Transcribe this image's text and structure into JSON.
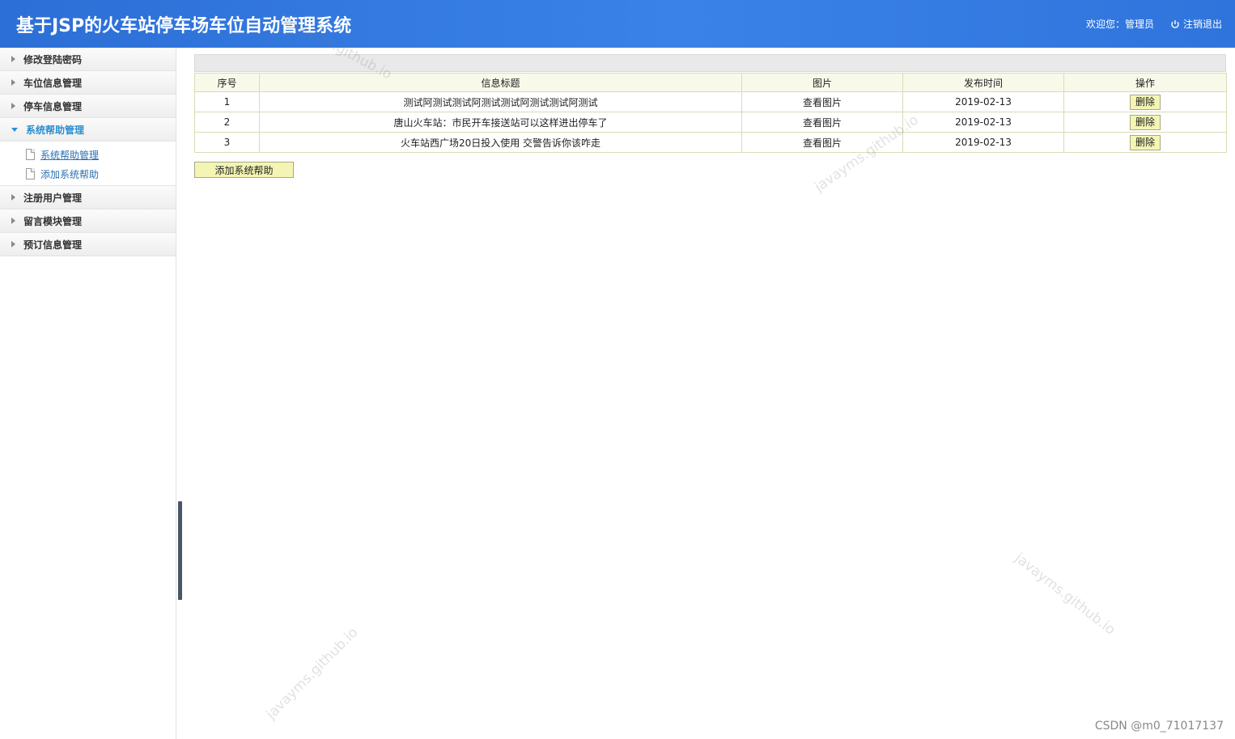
{
  "header": {
    "title": "基于JSP的火车站停车场车位自动管理系统",
    "welcome": "欢迎您：管理员",
    "logout": "注销退出",
    "logout_icon": "power-icon"
  },
  "sidebar": {
    "items": [
      {
        "label": "修改登陆密码",
        "expanded": false
      },
      {
        "label": "车位信息管理",
        "expanded": false
      },
      {
        "label": "停车信息管理",
        "expanded": false
      },
      {
        "label": "系统帮助管理",
        "expanded": true,
        "children": [
          {
            "label": "系统帮助管理"
          },
          {
            "label": "添加系统帮助"
          }
        ]
      },
      {
        "label": "注册用户管理",
        "expanded": false
      },
      {
        "label": "留言模块管理",
        "expanded": false
      },
      {
        "label": "预订信息管理",
        "expanded": false
      }
    ]
  },
  "table": {
    "headers": [
      "序号",
      "信息标题",
      "图片",
      "发布时间",
      "操作"
    ],
    "rows": [
      {
        "index": "1",
        "title": "测试阿测试测试阿测试测试阿测试测试阿测试",
        "image": "查看图片",
        "date": "2019-02-13",
        "action": "删除"
      },
      {
        "index": "2",
        "title": "唐山火车站：市民开车接送站可以这样进出停车了",
        "image": "查看图片",
        "date": "2019-02-13",
        "action": "删除"
      },
      {
        "index": "3",
        "title": "火车站西广场20日投入使用 交警告诉你该咋走",
        "image": "查看图片",
        "date": "2019-02-13",
        "action": "删除"
      }
    ]
  },
  "add_button": "添加系统帮助",
  "watermarks": [
    "javayms.github.io",
    "javayms.github.io",
    "javayms.github.io",
    "javayms.github.io"
  ],
  "credit": "CSDN @m0_71017137",
  "colors": {
    "header_blue": "#2c6fd6",
    "active_menu": "#2c8ecf",
    "button_yellow": "#f4f5b4",
    "table_header": "#f9f9ea"
  }
}
